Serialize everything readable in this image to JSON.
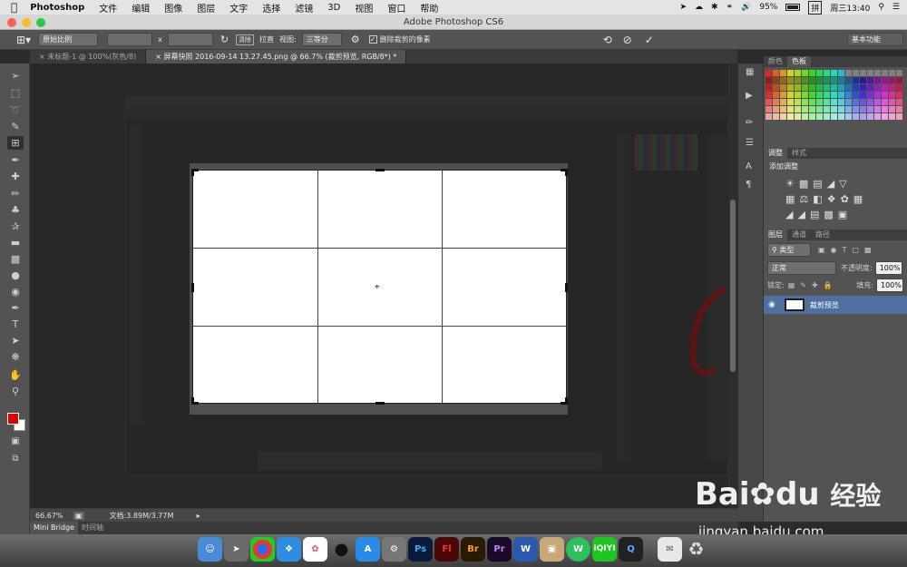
{
  "menubar": {
    "app_name": "Photoshop",
    "items": [
      "文件",
      "编辑",
      "图像",
      "图层",
      "文字",
      "选择",
      "滤镜",
      "3D",
      "视图",
      "窗口",
      "帮助"
    ],
    "battery": "95%",
    "clock": "周三13:40"
  },
  "window": {
    "title": "Adobe Photoshop CS6"
  },
  "options_bar": {
    "ratio_select": "原始比例",
    "x_sep": "x",
    "straighten_label": "拉直",
    "view_label": "视图:",
    "view_select": "三等分",
    "delete_pixels_label": "删除裁剪的像素",
    "workspace_select": "基本功能"
  },
  "doc_tabs": [
    {
      "label": "未标题-1 @ 100%(灰色/8)",
      "active": false
    },
    {
      "label": "屏幕快照 2016-09-14 13.27.45.png @ 66.7% (裁剪预览, RGB/8*) *",
      "active": true
    }
  ],
  "status_bar": {
    "zoom": "66.67%",
    "doc_info": "文档:3.89M/3.77M"
  },
  "bottom_tabs": [
    "Mini Bridge",
    "时间轴"
  ],
  "panels": {
    "color_tabs": [
      "颜色",
      "色板"
    ],
    "adjust_tabs": [
      "调整",
      "样式"
    ],
    "add_adjustment": "添加调整",
    "layers_tabs": [
      "图层",
      "通道",
      "路径"
    ],
    "filter_select": "类型",
    "blend_mode": "正常",
    "opacity_label": "不透明度:",
    "opacity_value": "100%",
    "lock_label": "锁定:",
    "fill_label": "填充:",
    "fill_value": "100%",
    "layer_name": "裁剪预览"
  },
  "colors": {
    "accent_red": "#e00000",
    "canvas_bg": "#282828",
    "panel_bg": "#535353"
  },
  "dock_apps": [
    "Finder",
    "Launchpad",
    "Chrome",
    "Safari",
    "Photos",
    "QQ",
    "App Store",
    "System Preferences",
    "Ps",
    "Fl",
    "Br",
    "Pr",
    "W",
    "Preview",
    "WeChat",
    "iQIYI",
    "QuickTime",
    "Mail",
    "Trash"
  ],
  "watermark": {
    "brand": "Bai",
    "brand2": "du",
    "cn": "经验",
    "url": "jingyan.baidu.com"
  }
}
